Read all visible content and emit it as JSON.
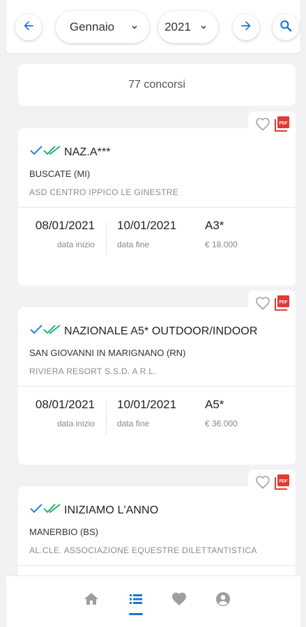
{
  "header": {
    "month": "Gennaio",
    "year": "2021"
  },
  "count_label": "77 concorsi",
  "cards": [
    {
      "title": "NAZ.A***",
      "place": "BUSCATE (MI)",
      "org": "ASD CENTRO IPPICO LE GINESTRE",
      "start_date": "08/01/2021",
      "start_label": "data inizio",
      "end_date": "10/01/2021",
      "end_label": "data fine",
      "category": "A3*",
      "prize": "€ 18.000"
    },
    {
      "title": "NAZIONALE A5* OUTDOOR/INDOOR",
      "place": "SAN GIOVANNI IN MARIGNANO (RN)",
      "org": "RIVIERA RESORT S.S.D. A R.L.",
      "start_date": "08/01/2021",
      "start_label": "data inizio",
      "end_date": "10/01/2021",
      "end_label": "data fine",
      "category": "A5*",
      "prize": "€ 36.000"
    },
    {
      "title": "INIZIAMO L'ANNO",
      "place": "MANERBIO (BS)",
      "org": "AL.CLE. ASSOCIAZIONE EQUESTRE DILETTANTISTICA"
    }
  ],
  "icons": {
    "back": "arrow-left-icon",
    "forward": "arrow-right-icon",
    "search": "search-icon",
    "favorite": "heart-outline-icon",
    "pdf": "pdf-icon",
    "home": "home-icon",
    "list": "list-icon",
    "favorites_tab": "heart-icon",
    "profile": "account-icon"
  },
  "colors": {
    "accent": "#1976d2",
    "check_blue": "#1e88e5",
    "check_green": "#26b36e",
    "pdf_red": "#e53935",
    "icon_gray": "#9e9e9e"
  }
}
